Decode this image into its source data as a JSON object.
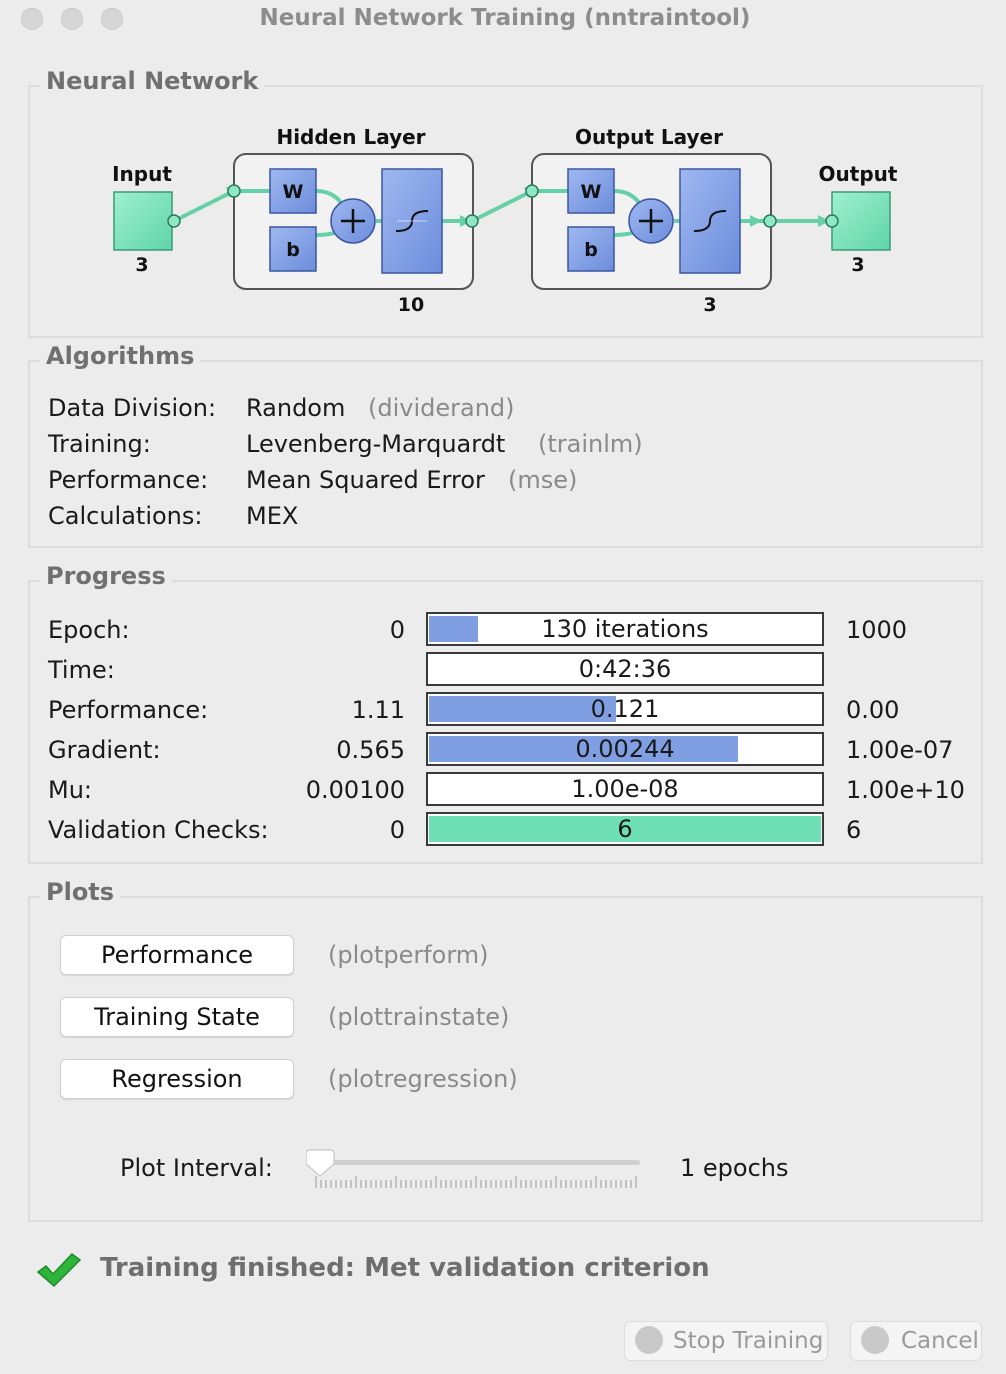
{
  "window": {
    "title": "Neural Network Training (nntraintool)"
  },
  "network": {
    "section_title": "Neural Network",
    "input_label": "Input",
    "input_size": "3",
    "hidden_layer_label": "Hidden Layer",
    "hidden_size": "10",
    "output_layer_label": "Output Layer",
    "output_layer_size": "3",
    "output_label": "Output",
    "output_size": "3",
    "weight_symbol": "W",
    "bias_symbol": "b"
  },
  "algorithms": {
    "section_title": "Algorithms",
    "rows": [
      {
        "label": "Data Division:",
        "value": "Random",
        "fn": "(dividerand)"
      },
      {
        "label": "Training:",
        "value": "Levenberg-Marquardt",
        "fn": "(trainlm)"
      },
      {
        "label": "Performance:",
        "value": "Mean Squared Error",
        "fn": "(mse)"
      },
      {
        "label": "Calculations:",
        "value": "MEX",
        "fn": ""
      }
    ]
  },
  "progress": {
    "section_title": "Progress",
    "rows": [
      {
        "label": "Epoch:",
        "min": "0",
        "current": "130 iterations",
        "max": "1000",
        "fill_fraction": 0.13,
        "fill_color": "#7f9fe2"
      },
      {
        "label": "Time:",
        "min": "",
        "current": "0:42:36",
        "max": "",
        "fill_fraction": 0,
        "fill_color": "#7f9fe2"
      },
      {
        "label": "Performance:",
        "min": "1.11",
        "current": "0.121",
        "max": "0.00",
        "fill_fraction": 0.48,
        "fill_color": "#7f9fe2"
      },
      {
        "label": "Gradient:",
        "min": "0.565",
        "current": "0.00244",
        "max": "1.00e-07",
        "fill_fraction": 0.79,
        "fill_color": "#7f9fe2"
      },
      {
        "label": "Mu:",
        "min": "0.00100",
        "current": "1.00e-08",
        "max": "1.00e+10",
        "fill_fraction": 0,
        "fill_color": "#7f9fe2"
      },
      {
        "label": "Validation Checks:",
        "min": "0",
        "current": "6",
        "max": "6",
        "fill_fraction": 1.0,
        "fill_color": "#6fe0b6"
      }
    ]
  },
  "plots": {
    "section_title": "Plots",
    "buttons": [
      {
        "label": "Performance",
        "fn": "(plotperform)"
      },
      {
        "label": "Training State",
        "fn": "(plottrainstate)"
      },
      {
        "label": "Regression",
        "fn": "(plotregression)"
      }
    ],
    "interval_label": "Plot Interval:",
    "interval_value": "1 epochs",
    "interval_slider_fraction": 0.0
  },
  "status": {
    "text": "Training finished: Met validation criterion",
    "stop_label": "Stop Training",
    "cancel_label": "Cancel"
  },
  "colors": {
    "accent_blue": "#7f9fe2",
    "accent_green": "#6fe0b6",
    "check_green": "#2db53a"
  }
}
